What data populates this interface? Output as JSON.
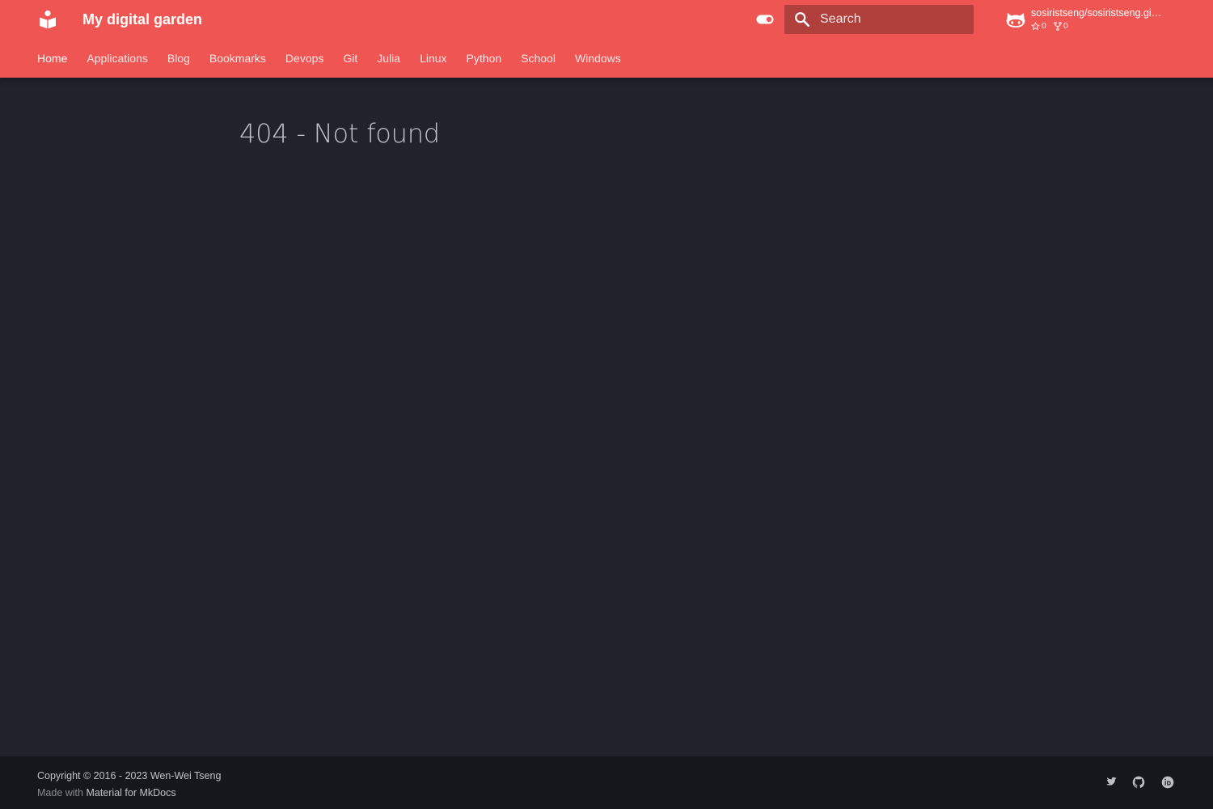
{
  "header": {
    "title": "My digital garden",
    "logo_icon": "book-reader-icon",
    "accent_color": "#ef5552",
    "palette_toggle_icon": "toggle-switch-icon"
  },
  "search": {
    "placeholder": "Search",
    "icon": "search-icon"
  },
  "repo": {
    "name": "sosiristseng/sosiristseng.gi…",
    "stars": "0",
    "forks": "0",
    "icon": "github-octocat-icon"
  },
  "tabs": [
    {
      "label": "Home"
    },
    {
      "label": "Applications"
    },
    {
      "label": "Blog"
    },
    {
      "label": "Bookmarks"
    },
    {
      "label": "Devops"
    },
    {
      "label": "Git"
    },
    {
      "label": "Julia"
    },
    {
      "label": "Linux"
    },
    {
      "label": "Python"
    },
    {
      "label": "School"
    },
    {
      "label": "Windows"
    }
  ],
  "main": {
    "title": "404 - Not found"
  },
  "footer": {
    "copyright": "Copyright © 2016 - 2023 Wen-Wei Tseng",
    "made_with_prefix": "Made with",
    "made_with_link": "Material for MkDocs",
    "social_icons": [
      "twitter-icon",
      "github-icon",
      "orcid-icon"
    ],
    "background_color": "#16171d"
  },
  "page_background_color": "#21222c"
}
